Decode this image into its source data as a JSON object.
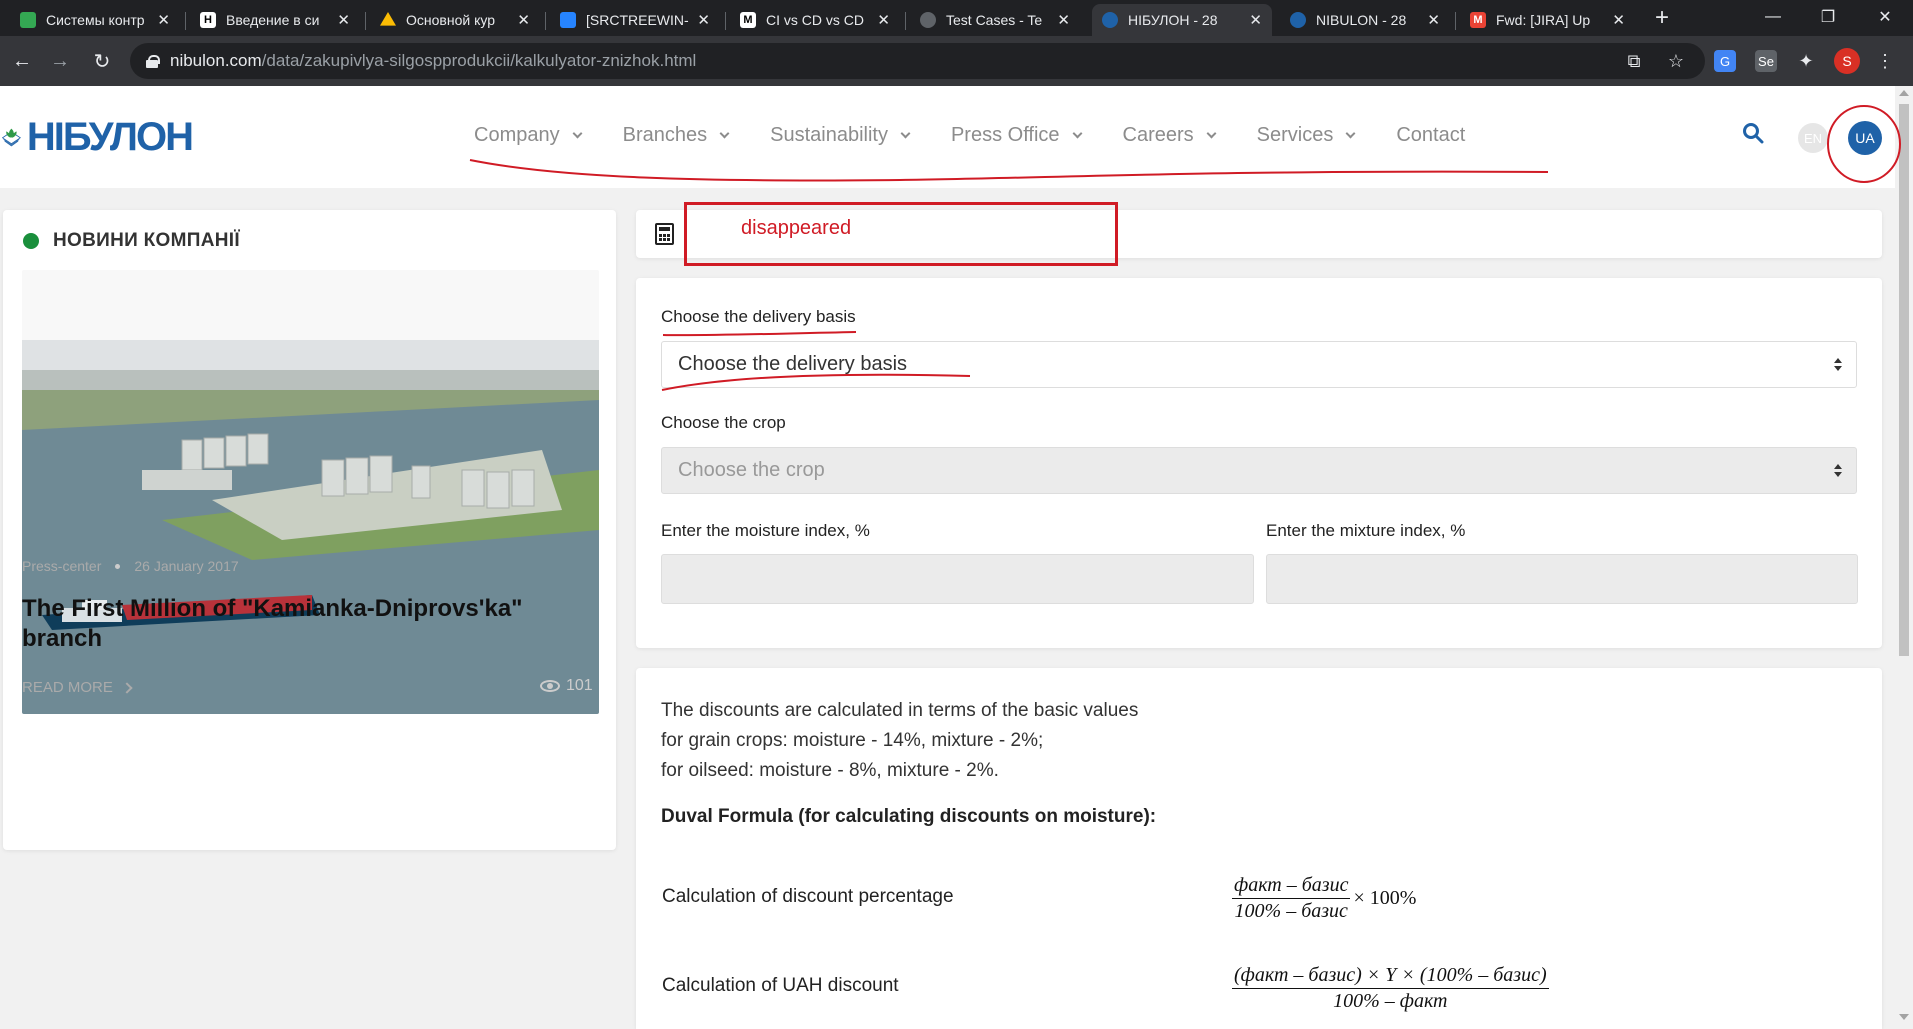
{
  "browser": {
    "tabs": [
      {
        "title": "Системы контр",
        "color": "#e37400"
      },
      {
        "title": "Введение в си",
        "color": "#ffffff"
      },
      {
        "title": "Основной кур",
        "color": "#1fa463"
      },
      {
        "title": "[SRCTREEWIN-",
        "color": "#2684ff"
      },
      {
        "title": "CI vs CD vs CD",
        "color": "#111111"
      },
      {
        "title": "Test Cases - Te",
        "color": "#5f6368"
      },
      {
        "title": "НІБУЛОН - 28",
        "color": "#1f62a8"
      },
      {
        "title": "NIBULON - 28",
        "color": "#1f62a8"
      },
      {
        "title": "Fwd: [JIRA] Up",
        "color": "#ea4335"
      }
    ],
    "url_host": "nibulon.com",
    "url_path": "/data/zakupivlya-silgospprodukcii/kalkulyator-znizhok.html",
    "profile_letter": "S"
  },
  "header": {
    "nav": [
      "Company",
      "Branches",
      "Sustainability",
      "Press Office",
      "Careers",
      "Services",
      "Contact"
    ],
    "nav_has_dropdown": [
      true,
      true,
      true,
      true,
      true,
      true,
      false
    ],
    "lang_en": "EN",
    "lang_ua": "UA"
  },
  "news": {
    "section_title": "НОВИНИ КОМПАНІЇ",
    "category": "Press-center",
    "date": "26 January 2017",
    "headline": "The First Million of \"Kamianka-Dniprovs'ka\" branch",
    "read_more": "READ MORE",
    "views": "101"
  },
  "calculator": {
    "delivery_label": "Choose the delivery basis",
    "delivery_placeholder": "Choose the delivery basis",
    "crop_label": "Choose the crop",
    "crop_placeholder": "Choose the crop",
    "moisture_label": "Enter the moisture index, %",
    "mixture_label": "Enter the mixture index, %"
  },
  "info": {
    "line1": "The discounts are calculated in terms of the basic values",
    "line2": "for grain crops: moisture - 14%, mixture - 2%;",
    "line3": "for oilseed: moisture - 8%, mixture - 2%.",
    "duval_title": "Duval Formula (for calculating discounts on moisture):",
    "row1_label": "Calculation of discount percentage",
    "row1_num": "факт – базис",
    "row1_den": "100% – базис",
    "row1_mult": "× 100%",
    "row2_label": "Calculation of UAH discount",
    "row2_num": "(факт – базис) × Y × (100% – базис)",
    "row2_den": "100% – факт"
  },
  "annotation": {
    "text": "disappeared",
    "color": "#d01b25"
  }
}
